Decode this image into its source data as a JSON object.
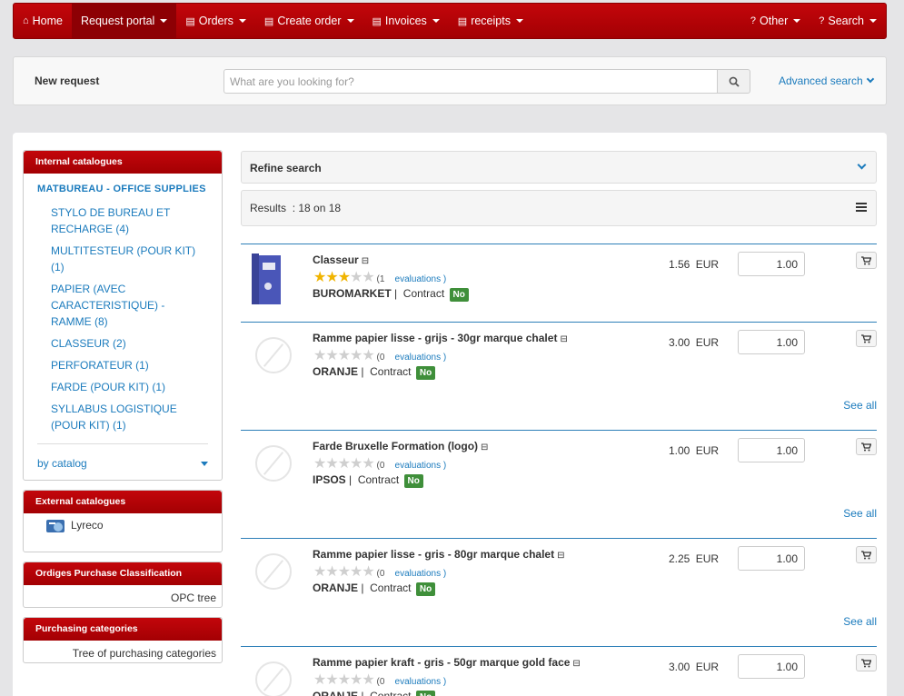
{
  "nav": {
    "items": [
      {
        "label": "Home",
        "icon": "home-icon"
      },
      {
        "label": "Request portal",
        "icon": "",
        "dropdown": true
      },
      {
        "label": "Orders",
        "icon": "book-icon",
        "dropdown": true
      },
      {
        "label": "Create order",
        "icon": "book-icon",
        "dropdown": true
      },
      {
        "label": "Invoices",
        "icon": "book-icon",
        "dropdown": true
      },
      {
        "label": "receipts",
        "icon": "book-icon",
        "dropdown": true
      }
    ],
    "right": [
      {
        "label": "Other",
        "icon": "question-circle-icon"
      },
      {
        "label": "Search",
        "icon": "question-circle-icon"
      }
    ]
  },
  "searchbar": {
    "new_request": "New request",
    "placeholder": "What are you looking for?",
    "advanced": "Advanced search"
  },
  "sidebar": {
    "internal_title": "Internal catalogues",
    "catalog_name": "MATBUREAU -  OFFICE SUPPLIES",
    "categories": [
      "STYLO DE BUREAU ET RECHARGE (4)",
      "MULTITESTEUR (POUR KIT) (1)",
      "PAPIER (AVEC CARACTERISTIQUE) - RAMME (8)",
      "CLASSEUR (2)",
      "PERFORATEUR (1)",
      "FARDE (POUR KIT) (1)",
      "SYLLABUS LOGISTIQUE (POUR KIT) (1)"
    ],
    "by_catalog": "by catalog",
    "external_title": "External catalogues",
    "external_item": "Lyreco",
    "ordiges_title": "Ordiges Purchase Classification",
    "ordiges_link": "OPC tree",
    "purchasing_title": "Purchasing categories",
    "purchasing_link": "Tree of purchasing categories"
  },
  "refine": {
    "label": "Refine search"
  },
  "results": {
    "label": "Results",
    "count": ": 18 on 18"
  },
  "products": [
    {
      "name": "Classeur",
      "rating": 3,
      "evals": "(1",
      "evals_label": "evaluations )",
      "seller": "BUROMARKET",
      "contract": "Contract",
      "badge": "No",
      "price": "1.56 EUR",
      "qty": "1.00",
      "see_all": ""
    },
    {
      "name": "Ramme papier lisse - grijs - 30gr marque chalet",
      "rating": 0,
      "evals": "(0",
      "evals_label": "evaluations )",
      "seller": "ORANJE",
      "contract": "Contract",
      "badge": "No",
      "price": "3.00 EUR",
      "qty": "1.00",
      "see_all": "See all"
    },
    {
      "name": "Farde Bruxelle Formation (logo)",
      "rating": 0,
      "evals": "(0",
      "evals_label": "evaluations )",
      "seller": "IPSOS",
      "contract": "Contract",
      "badge": "No",
      "price": "1.00 EUR",
      "qty": "1.00",
      "see_all": "See all"
    },
    {
      "name": "Ramme papier lisse - gris - 80gr marque chalet",
      "rating": 0,
      "evals": "(0",
      "evals_label": "evaluations )",
      "seller": "ORANJE",
      "contract": "Contract",
      "badge": "No",
      "price": "2.25 EUR",
      "qty": "1.00",
      "see_all": "See all"
    },
    {
      "name": "Ramme papier kraft - gris - 50gr marque gold face",
      "rating": 0,
      "evals": "(0",
      "evals_label": "evaluations )",
      "seller": "ORANJE",
      "contract": "Contract",
      "badge": "No",
      "price": "3.00 EUR",
      "qty": "1.00",
      "see_all": ""
    }
  ],
  "colors": {
    "brand": "#b5050a",
    "link": "#1b7bbd",
    "badge": "#3f8f3a",
    "star": "#f0b400"
  }
}
